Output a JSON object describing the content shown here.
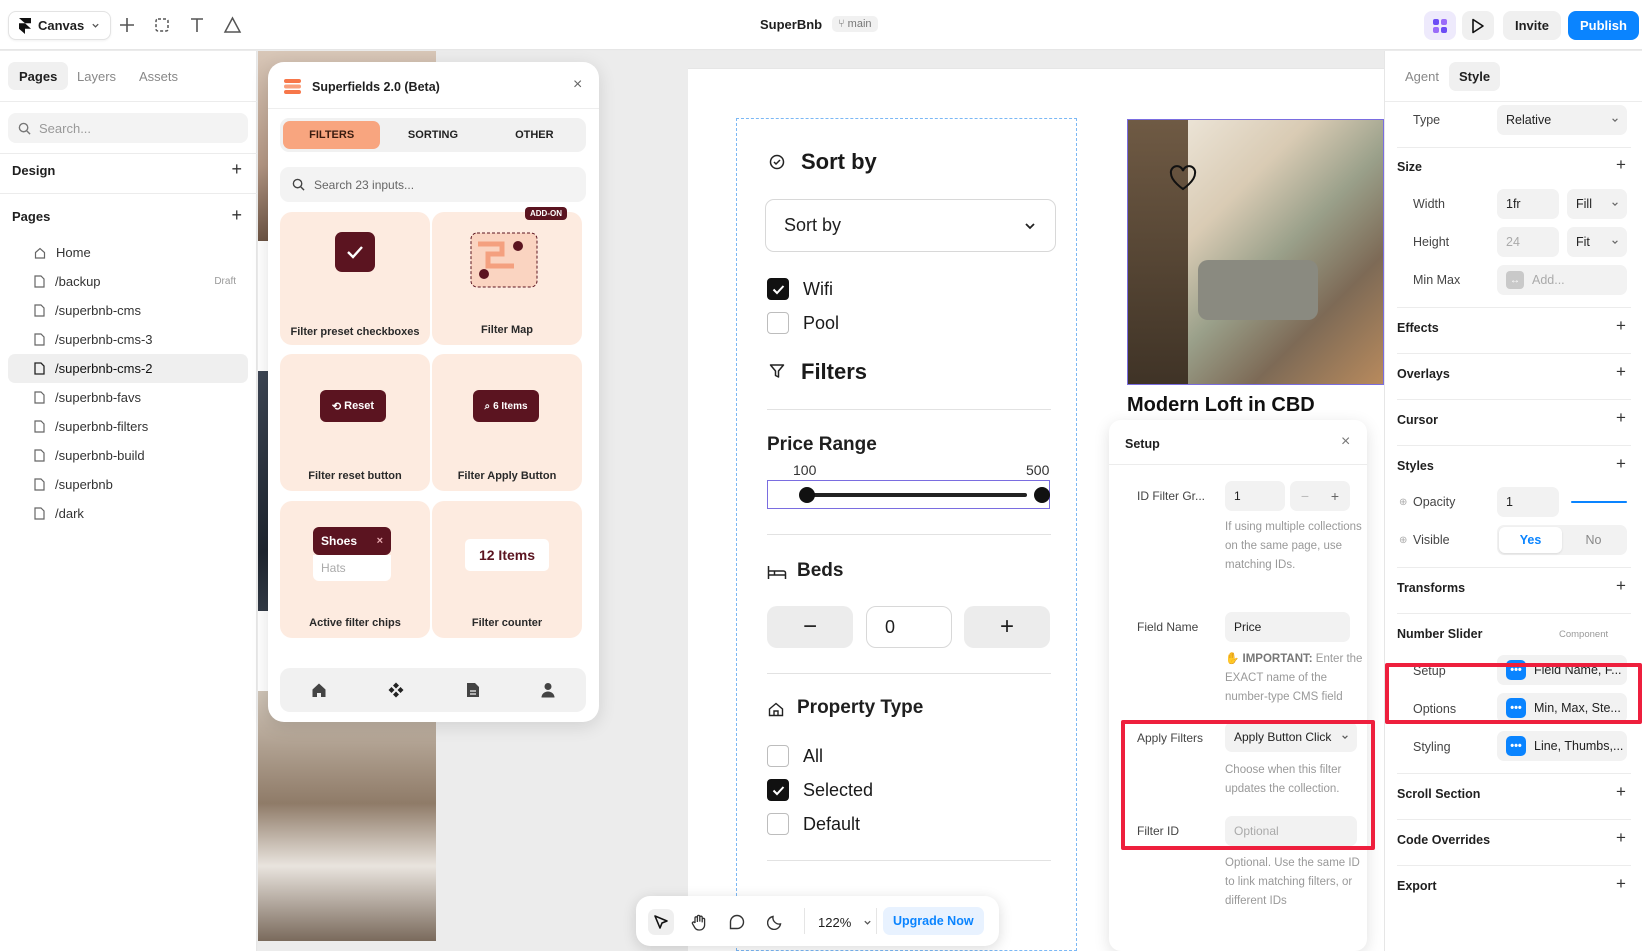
{
  "topbar": {
    "canvas_label": "Canvas",
    "project_name": "SuperBnb",
    "branch": "main",
    "invite": "Invite",
    "publish": "Publish"
  },
  "left": {
    "tabs": [
      "Pages",
      "Layers",
      "Assets"
    ],
    "search_placeholder": "Search...",
    "design_label": "Design",
    "pages_label": "Pages",
    "pages": [
      {
        "name": "Home",
        "badge": ""
      },
      {
        "name": "/backup",
        "badge": "Draft"
      },
      {
        "name": "/superbnb-cms",
        "badge": ""
      },
      {
        "name": "/superbnb-cms-3",
        "badge": ""
      },
      {
        "name": "/superbnb-cms-2",
        "badge": ""
      },
      {
        "name": "/superbnb-favs",
        "badge": ""
      },
      {
        "name": "/superbnb-filters",
        "badge": ""
      },
      {
        "name": "/superbnb-build",
        "badge": ""
      },
      {
        "name": "/superbnb",
        "badge": ""
      },
      {
        "name": "/dark",
        "badge": ""
      }
    ],
    "selected_page": "/superbnb-cms-2"
  },
  "superfields": {
    "title": "Superfields 2.0 (Beta)",
    "tabs": [
      "FILTERS",
      "SORTING",
      "OTHER"
    ],
    "active_tab": "FILTERS",
    "search_placeholder": "Search 23 inputs...",
    "addon_badge": "ADD-ON",
    "cards": {
      "preset_checkboxes": "Filter preset checkboxes",
      "map": "Filter Map",
      "reset_button": "Filter reset button",
      "reset_chip": "Reset",
      "apply_button": "Filter Apply Button",
      "apply_chip": "6 Items",
      "active_chips": "Active filter chips",
      "chip_shoes": "Shoes",
      "chip_hats": "Hats",
      "counter": "Filter counter",
      "counter_value": "12 Items"
    }
  },
  "page": {
    "sort_heading": "Sort by",
    "sort_select": "Sort by",
    "wifi": "Wifi",
    "pool": "Pool",
    "filters_heading": "Filters",
    "price_heading": "Price Range",
    "price_min": "100",
    "price_max": "500",
    "beds_heading": "Beds",
    "beds_value": "0",
    "property_heading": "Property Type",
    "property_options": [
      "All",
      "Selected",
      "Default"
    ],
    "listing_title": "Modern Loft in CBD",
    "checks": {
      "wifi": true,
      "pool": false,
      "all": false,
      "selected": true,
      "default": false
    }
  },
  "setup": {
    "title": "Setup",
    "id_label": "ID Filter Gr...",
    "id_value": "1",
    "id_help": "If using multiple collections on the same page, use matching IDs.",
    "field_label": "Field Name",
    "field_value": "Price",
    "field_help_strong": "IMPORTANT:",
    "field_help": " Enter the EXACT name of the number-type CMS field",
    "apply_label": "Apply Filters",
    "apply_value": "Apply Button Click",
    "apply_help": "Choose when this filter updates the collection.",
    "filterid_label": "Filter ID",
    "filterid_placeholder": "Optional",
    "filterid_help": "Optional. Use the same ID to link matching filters, or different IDs"
  },
  "toolbar": {
    "zoom": "122%",
    "upgrade": "Upgrade Now"
  },
  "right": {
    "tabs": [
      "Agent",
      "Style"
    ],
    "type_label": "Type",
    "type_value": "Relative",
    "size_label": "Size",
    "width_label": "Width",
    "width_value": "1fr",
    "width_mode": "Fill",
    "height_label": "Height",
    "height_value": "24",
    "height_mode": "Fit",
    "minmax_label": "Min Max",
    "minmax_placeholder": "Add...",
    "effects": "Effects",
    "overlays": "Overlays",
    "cursor": "Cursor",
    "styles": "Styles",
    "opacity_label": "Opacity",
    "opacity_value": "1",
    "opacity_fraction": 1,
    "visible_label": "Visible",
    "visible_yes": "Yes",
    "visible_no": "No",
    "transforms": "Transforms",
    "component_title": "Number Slider",
    "component_tag": "Component",
    "setup_label": "Setup",
    "setup_value": "Field Name, F...",
    "options_label": "Options",
    "options_value": "Min, Max, Ste...",
    "styling_label": "Styling",
    "styling_value": "Line, Thumbs,...",
    "scroll_section": "Scroll Section",
    "code_overrides": "Code Overrides",
    "export": "Export",
    "accent": "#0a84ff",
    "highlight": "#ee1f3d"
  }
}
